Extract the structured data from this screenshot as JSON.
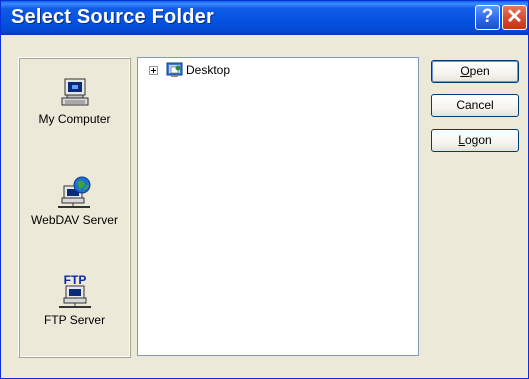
{
  "window": {
    "title": "Select Source Folder",
    "help_label": "?",
    "close_label": "✕"
  },
  "places": [
    {
      "label": "My Computer",
      "icon": "my-computer-icon"
    },
    {
      "label": "WebDAV Server",
      "icon": "webdav-server-icon"
    },
    {
      "label": "FTP Server",
      "icon": "ftp-server-icon",
      "icon_text": "FTP"
    }
  ],
  "tree": {
    "root": {
      "label": "Desktop",
      "expander": "+",
      "icon": "desktop-icon"
    }
  },
  "buttons": {
    "open": {
      "first": "O",
      "rest": "pen"
    },
    "cancel": {
      "label": "Cancel"
    },
    "logon": {
      "first": "L",
      "rest": "ogon"
    }
  },
  "colors": {
    "titlebar": "#0551e0",
    "dialog": "#ece9d8",
    "close": "#d6462a"
  }
}
